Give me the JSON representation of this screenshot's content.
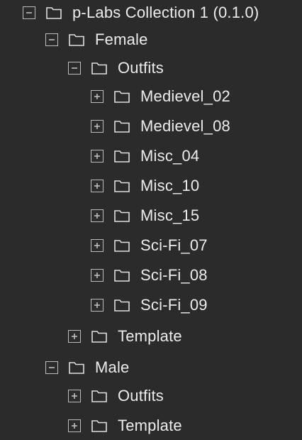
{
  "tree": {
    "root": {
      "label": "p-Labs Collection 1 (0.1.0)",
      "expanded": true
    },
    "female": {
      "label": "Female",
      "expanded": true
    },
    "female_outfits": {
      "label": "Outfits",
      "expanded": true
    },
    "female_outfits_items": [
      {
        "label": "Medievel_02",
        "expanded": false
      },
      {
        "label": "Medievel_08",
        "expanded": false
      },
      {
        "label": "Misc_04",
        "expanded": false
      },
      {
        "label": "Misc_10",
        "expanded": false
      },
      {
        "label": "Misc_15",
        "expanded": false
      },
      {
        "label": "Sci-Fi_07",
        "expanded": false
      },
      {
        "label": "Sci-Fi_08",
        "expanded": false
      },
      {
        "label": "Sci-Fi_09",
        "expanded": false
      }
    ],
    "female_template": {
      "label": "Template",
      "expanded": false
    },
    "male": {
      "label": "Male",
      "expanded": true
    },
    "male_outfits": {
      "label": "Outfits",
      "expanded": false
    },
    "male_template": {
      "label": "Template",
      "expanded": false
    }
  },
  "icons": {
    "expand": "plus-box-icon",
    "collapse": "minus-box-icon",
    "folder": "folder-icon"
  },
  "colors": {
    "background": "#2b2b2b",
    "text": "#ececec",
    "icon": "#bdbdbd"
  }
}
